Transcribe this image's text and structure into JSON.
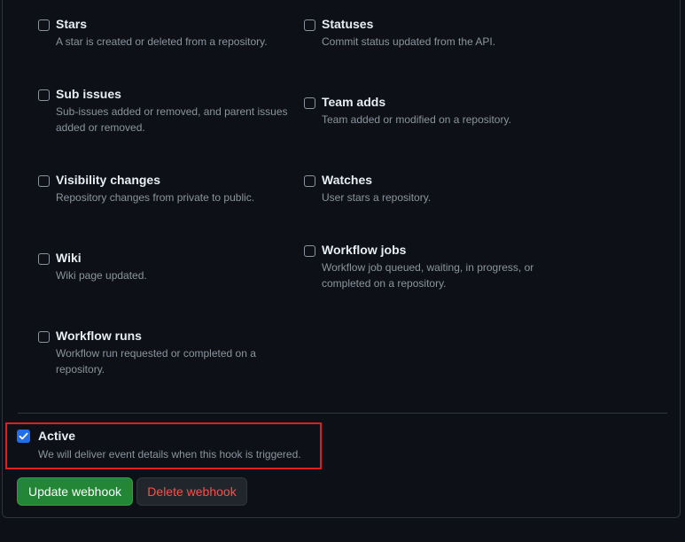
{
  "events": [
    {
      "title": "Stars",
      "description": "A star is created or deleted from a repository."
    },
    {
      "title": "Statuses",
      "description": "Commit status updated from the API."
    },
    {
      "title": "Sub issues",
      "description": "Sub-issues added or removed, and parent issues added or removed."
    },
    {
      "title": "Team adds",
      "description": "Team added or modified on a repository."
    },
    {
      "title": "Visibility changes",
      "description": "Repository changes from private to public."
    },
    {
      "title": "Watches",
      "description": "User stars a repository."
    },
    {
      "title": "Wiki",
      "description": "Wiki page updated."
    },
    {
      "title": "Workflow jobs",
      "description": "Workflow job queued, waiting, in progress, or completed on a repository."
    },
    {
      "title": "Workflow runs",
      "description": "Workflow run requested or completed on a repository."
    }
  ],
  "active": {
    "title": "Active",
    "description": "We will deliver event details when this hook is triggered.",
    "checked": true
  },
  "buttons": {
    "update_label": "Update webhook",
    "delete_label": "Delete webhook"
  },
  "colors": {
    "background": "#0d1117",
    "accent_checkbox": "#1f6feb",
    "primary_button": "#238636",
    "danger_text": "#f85149",
    "highlight_border": "#e11d1d"
  }
}
